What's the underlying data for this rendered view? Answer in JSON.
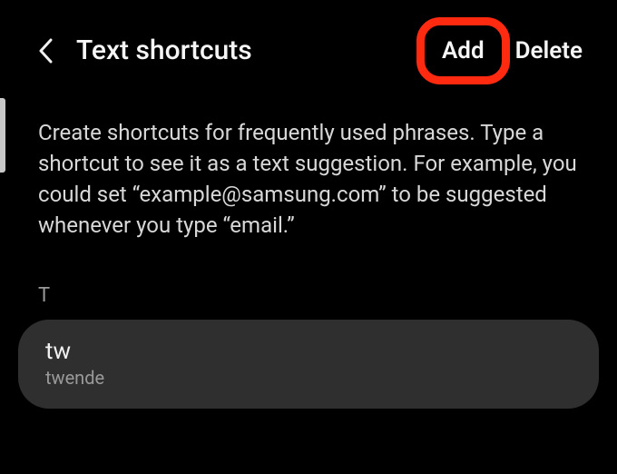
{
  "header": {
    "title": "Text shortcuts",
    "actions": {
      "add": "Add",
      "delete": "Delete"
    }
  },
  "description": "Create shortcuts for frequently used phrases. Type a shortcut to see it as a text suggestion. For example, you could set “example@samsung.com” to be suggested whenever you type “email.”",
  "section_letter": "T",
  "shortcuts": [
    {
      "key": "tw",
      "phrase": "twende"
    }
  ]
}
